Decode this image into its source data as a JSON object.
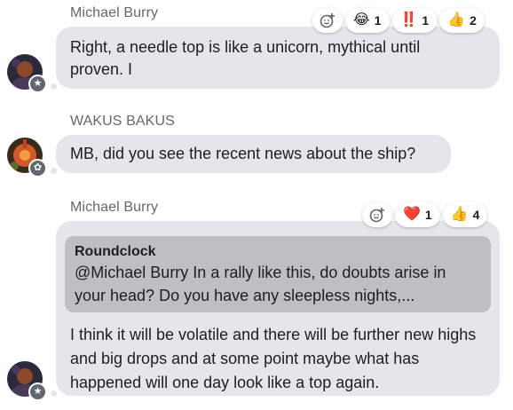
{
  "messages": [
    {
      "sender": "Michael Burry",
      "text": "Right, a needle top is like a unicorn, mythical until proven. I",
      "reactions": [
        {
          "emoji": "😂",
          "name": "laugh-reaction",
          "count": "1"
        },
        {
          "emoji": "‼️",
          "name": "double-exclamation-reaction",
          "count": "1"
        },
        {
          "emoji": "👍",
          "name": "thumbs-up-reaction",
          "count": "2"
        }
      ],
      "badge_icon": "star-icon"
    },
    {
      "sender": "WAKUS BAKUS",
      "text": "MB, did you see the recent news about the ship?",
      "badge_icon": "flower-icon"
    },
    {
      "sender": "Michael Burry",
      "quote": {
        "author": "Roundclock",
        "text": "@Michael Burry In a rally like this, do doubts arise in your head? Do you have any sleepless nights,..."
      },
      "text": "I think it will be volatile and there will be further new highs and big drops and at some point maybe what has happened will one day look like a top again.",
      "reactions": [
        {
          "emoji": "❤️",
          "name": "heart-reaction",
          "count": "1"
        },
        {
          "emoji": "👍",
          "name": "thumbs-up-reaction",
          "count": "4"
        }
      ],
      "badge_icon": "star-icon"
    }
  ],
  "glyphs": {
    "star": "★",
    "flower": "✿"
  },
  "colors": {
    "bubble": "#e4e6eb",
    "quote": "#bcc0c4",
    "sender_name": "#65676b",
    "badge": "#606770"
  }
}
